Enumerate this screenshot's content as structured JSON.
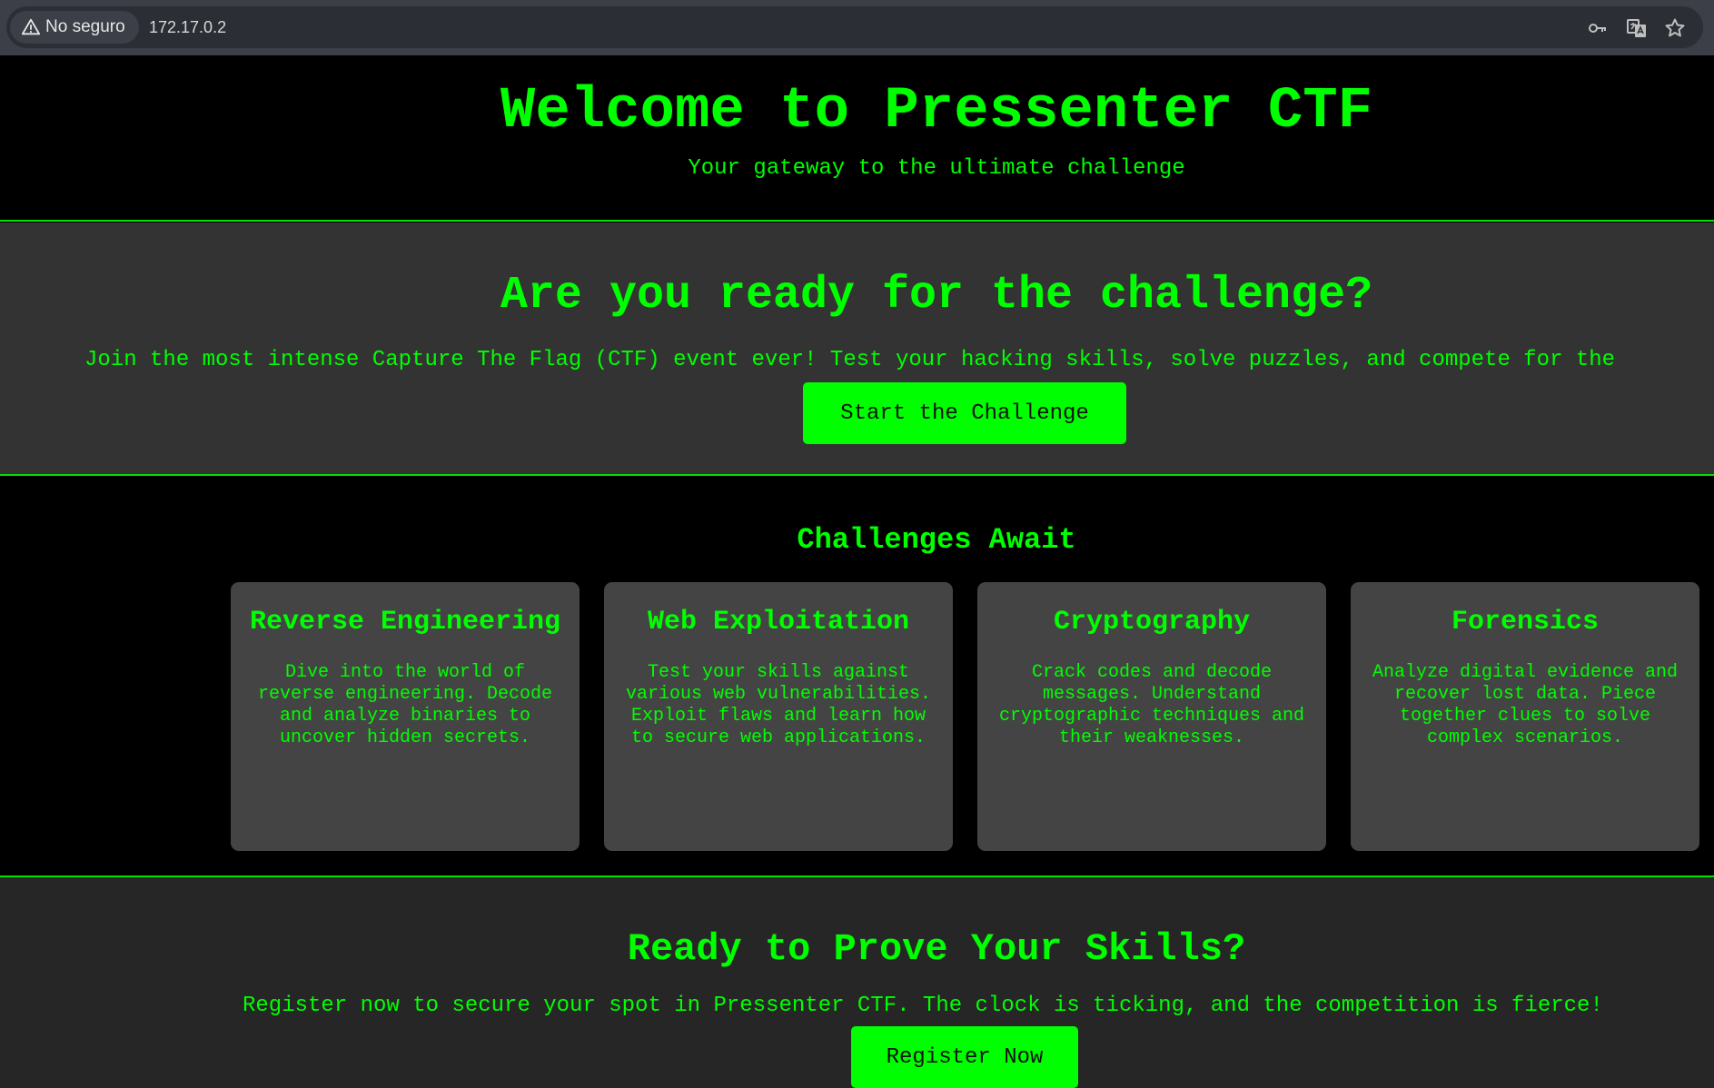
{
  "browser": {
    "security_label": "No seguro",
    "url": "172.17.0.2",
    "icons": [
      "warning-icon",
      "key-icon",
      "translate-icon",
      "star-icon"
    ]
  },
  "header": {
    "title": "Welcome to Pressenter CTF",
    "tagline": "Your gateway to the ultimate challenge"
  },
  "challenge": {
    "heading": "Are you ready for the challenge?",
    "text": "Join the most intense Capture The Flag (CTF) event ever! Test your hacking skills, solve puzzles, and compete for the",
    "button_label": "Start the Challenge"
  },
  "challenges_section": {
    "heading": "Challenges Await",
    "cards": [
      {
        "title": "Reverse Engineering",
        "description": "Dive into the world of reverse engineering. Decode and analyze binaries to uncover hidden secrets."
      },
      {
        "title": "Web Exploitation",
        "description": "Test your skills against various web vulnerabilities. Exploit flaws and learn how to secure web applications."
      },
      {
        "title": "Cryptography",
        "description": "Crack codes and decode messages. Understand cryptographic techniques and their weaknesses."
      },
      {
        "title": "Forensics",
        "description": "Analyze digital evidence and recover lost data. Piece together clues to solve complex scenarios."
      }
    ]
  },
  "register": {
    "heading": "Ready to Prove Your Skills?",
    "text": "Register now to secure your spot in Pressenter CTF. The clock is ticking, and the competition is fierce!",
    "button_label": "Register Now"
  },
  "colors": {
    "accent": "#00ff00",
    "background": "#000000",
    "panel": "#333333",
    "card": "#444444"
  }
}
